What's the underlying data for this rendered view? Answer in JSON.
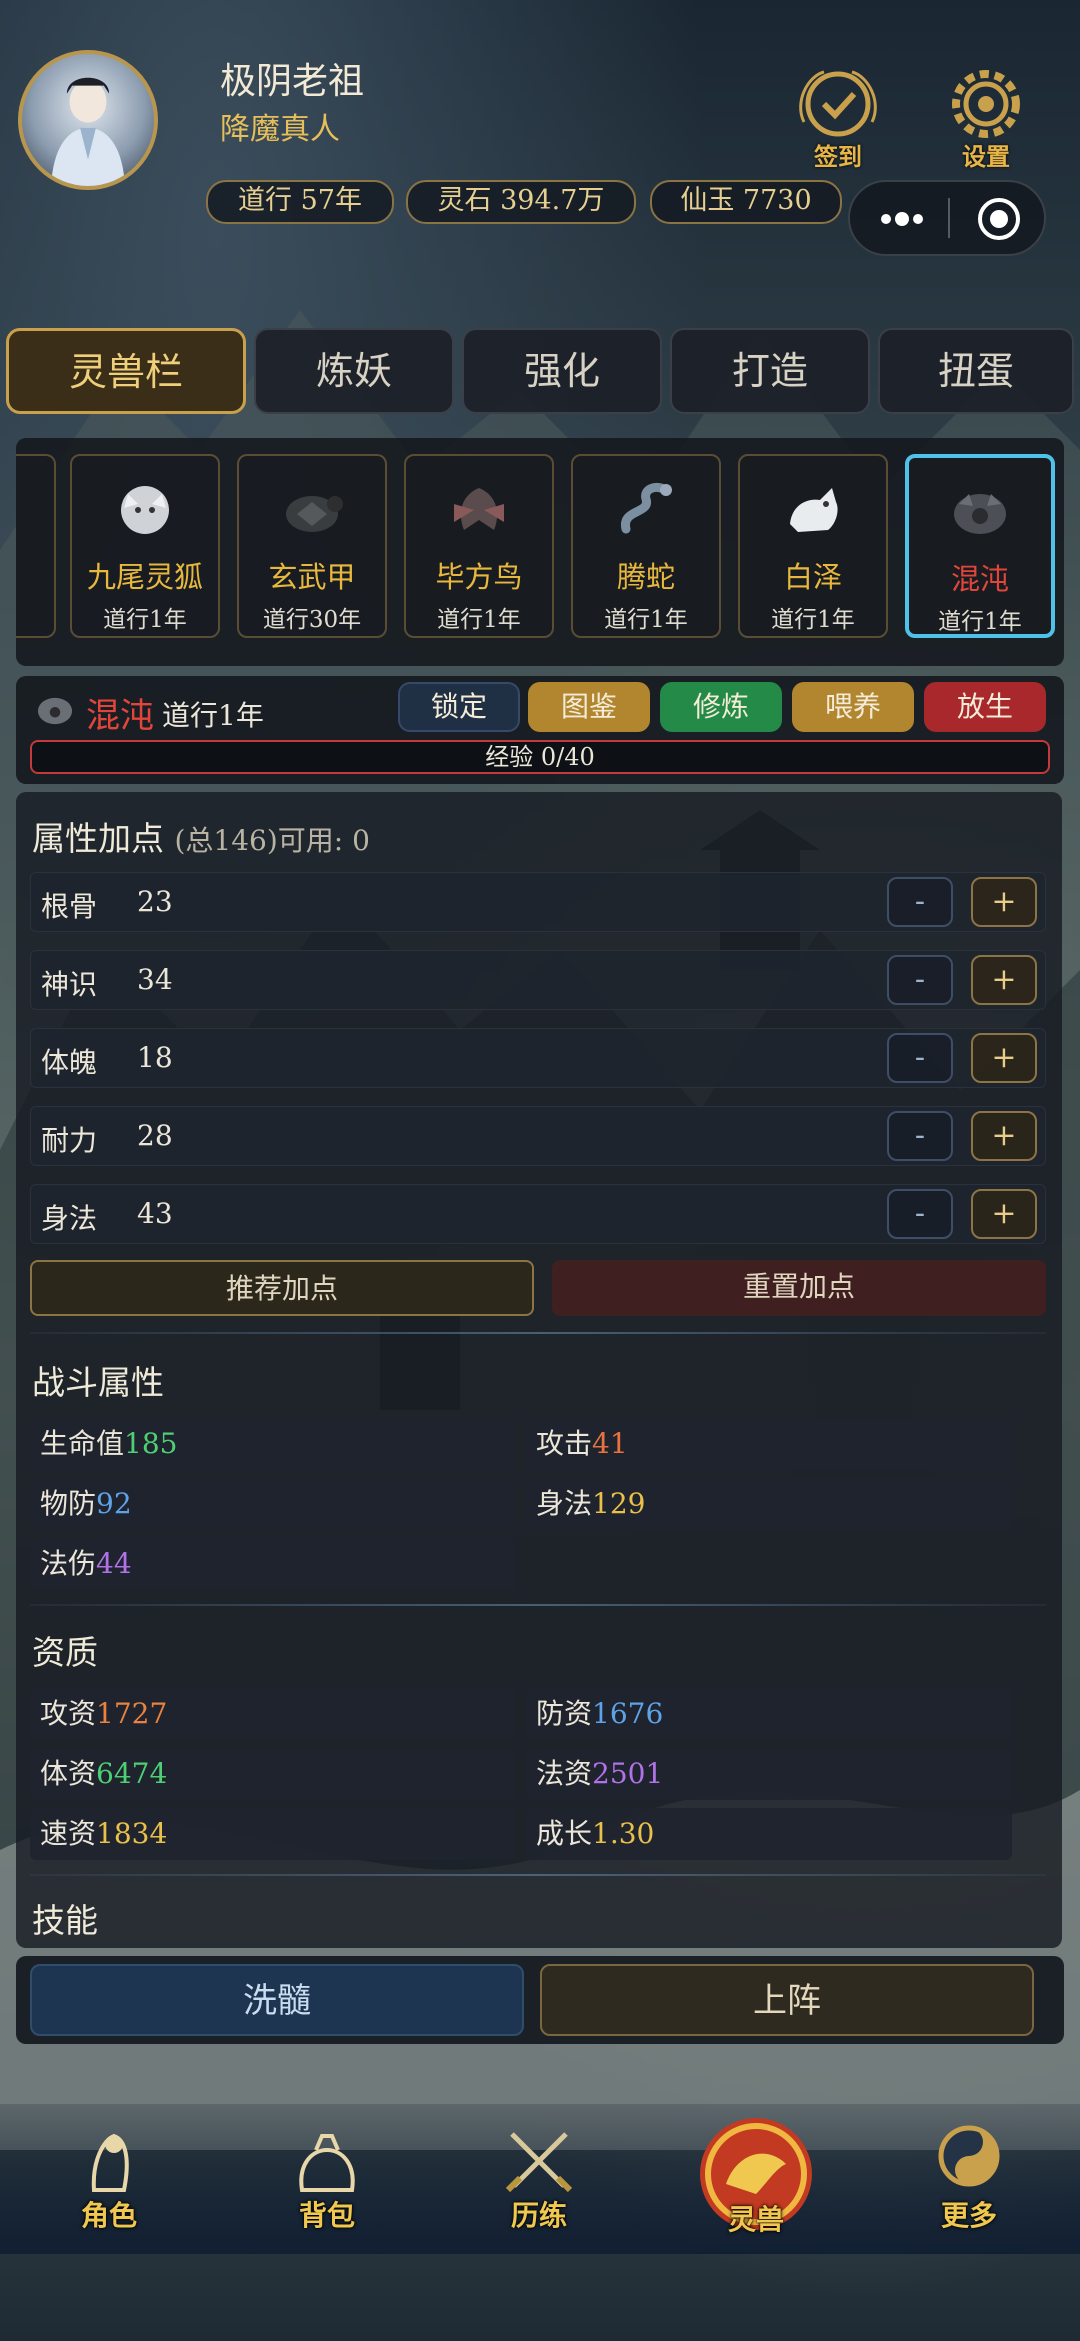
{
  "header": {
    "player_name": "极阴老祖",
    "player_title": "降魔真人",
    "stats": [
      "道行 57年",
      "灵石 394.7万",
      "仙玉 7730"
    ],
    "signin_label": "签到",
    "settings_label": "设置"
  },
  "tabs": [
    {
      "label": "灵兽栏",
      "active": true
    },
    {
      "label": "炼妖",
      "active": false
    },
    {
      "label": "强化",
      "active": false
    },
    {
      "label": "打造",
      "active": false
    },
    {
      "label": "扭蛋",
      "active": false
    }
  ],
  "pets": [
    {
      "name": "九尾灵狐",
      "level": "道行1年"
    },
    {
      "name": "玄武甲",
      "level": "道行30年"
    },
    {
      "name": "毕方鸟",
      "level": "道行1年"
    },
    {
      "name": "腾蛇",
      "level": "道行1年"
    },
    {
      "name": "白泽",
      "level": "道行1年"
    },
    {
      "name": "混沌",
      "level": "道行1年"
    }
  ],
  "selected": {
    "name": "混沌",
    "level": "道行1年",
    "actions": {
      "lock": "锁定",
      "codex": "图鉴",
      "train": "修炼",
      "feed": "喂养",
      "release": "放生"
    },
    "exp": "经验 0/40"
  },
  "attributes": {
    "title": "属性加点",
    "summary": "(总146)可用: 0",
    "rows": [
      {
        "key": "根骨",
        "value": "23"
      },
      {
        "key": "神识",
        "value": "34"
      },
      {
        "key": "体魄",
        "value": "18"
      },
      {
        "key": "耐力",
        "value": "28"
      },
      {
        "key": "身法",
        "value": "43"
      }
    ],
    "minus": "-",
    "plus": "+",
    "recommend": "推荐加点",
    "reset": "重置加点"
  },
  "combat": {
    "title": "战斗属性",
    "items": [
      {
        "label": "生命值",
        "value": "185",
        "color": "#4fcf73"
      },
      {
        "label": "攻击",
        "value": "41",
        "color": "#e8733f"
      },
      {
        "label": "物防",
        "value": "92",
        "color": "#5fa2e8"
      },
      {
        "label": "身法",
        "value": "129",
        "color": "#e8c04a"
      },
      {
        "label": "法伤",
        "value": "44",
        "color": "#b072e8"
      }
    ]
  },
  "aptitude": {
    "title": "资质",
    "items": [
      {
        "label": "攻资",
        "value": "1727",
        "color": "#e8833f"
      },
      {
        "label": "防资",
        "value": "1676",
        "color": "#5fa2e8"
      },
      {
        "label": "体资",
        "value": "6474",
        "color": "#4fcf73"
      },
      {
        "label": "法资",
        "value": "2501",
        "color": "#b072e8"
      },
      {
        "label": "速资",
        "value": "1834",
        "color": "#e8c04a"
      },
      {
        "label": "成长",
        "value": "1.30",
        "color": "#e8c04a"
      }
    ]
  },
  "skills_title": "技能",
  "bottom": {
    "wash": "洗髓",
    "deploy": "上阵"
  },
  "nav": [
    {
      "label": "角色",
      "icon": "character-icon"
    },
    {
      "label": "背包",
      "icon": "bag-icon"
    },
    {
      "label": "历练",
      "icon": "swords-icon"
    },
    {
      "label": "灵兽",
      "icon": "beast-icon",
      "active": true
    },
    {
      "label": "更多",
      "icon": "more-icon"
    }
  ]
}
